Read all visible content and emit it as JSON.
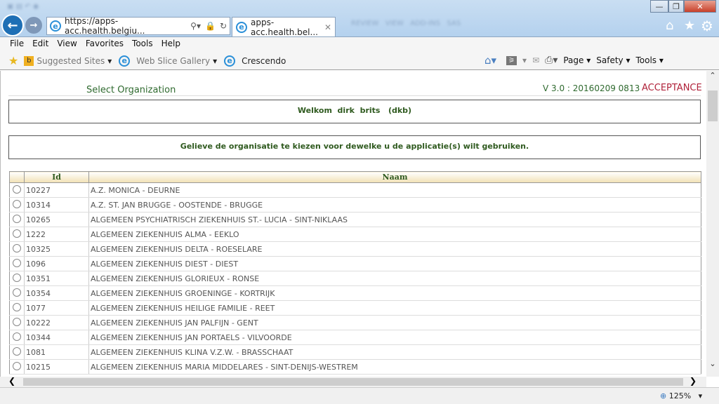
{
  "browser": {
    "address": "https://apps-acc.health.belgiu...",
    "tab_title": "apps-acc.health.bel...",
    "menu": [
      "File",
      "Edit",
      "View",
      "Favorites",
      "Tools",
      "Help"
    ],
    "favorites": [
      "Suggested Sites",
      "Web Slice Gallery",
      "Crescendo"
    ],
    "command_bar": [
      "Page",
      "Safety",
      "Tools"
    ],
    "zoom": "125%"
  },
  "page": {
    "title": "Select Organization",
    "version": "V 3.0 : 20160209 0813",
    "environment": "ACCEPTANCE",
    "welcome": "Welkom  dirk  brits   (dkb)",
    "instruction": "Gelieve de organisatie te kiezen voor dewelke u de applicatie(s) wilt gebruiken.",
    "columns": [
      "Id",
      "Naam"
    ],
    "rows": [
      {
        "id": "10227",
        "name": "A.Z. MONICA - DEURNE"
      },
      {
        "id": "10314",
        "name": "A.Z. ST. JAN BRUGGE - OOSTENDE - BRUGGE"
      },
      {
        "id": "10265",
        "name": "ALGEMEEN PSYCHIATRISCH ZIEKENHUIS ST.- LUCIA - SINT-NIKLAAS"
      },
      {
        "id": "1222",
        "name": "ALGEMEEN ZIEKENHUIS ALMA - EEKLO"
      },
      {
        "id": "10325",
        "name": "ALGEMEEN ZIEKENHUIS DELTA - ROESELARE"
      },
      {
        "id": "1096",
        "name": "ALGEMEEN ZIEKENHUIS DIEST - DIEST"
      },
      {
        "id": "10351",
        "name": "ALGEMEEN ZIEKENHUIS GLORIEUX - RONSE"
      },
      {
        "id": "10354",
        "name": "ALGEMEEN ZIEKENHUIS GROENINGE - KORTRIJK"
      },
      {
        "id": "1077",
        "name": "ALGEMEEN ZIEKENHUIS HEILIGE FAMILIE - REET"
      },
      {
        "id": "10222",
        "name": "ALGEMEEN ZIEKENHUIS JAN PALFIJN - GENT"
      },
      {
        "id": "10344",
        "name": "ALGEMEEN ZIEKENHUIS JAN PORTAELS - VILVOORDE"
      },
      {
        "id": "1081",
        "name": "ALGEMEEN ZIEKENHUIS KLINA V.Z.W. - BRASSCHAAT"
      },
      {
        "id": "10215",
        "name": "ALGEMEEN ZIEKENHUIS MARIA MIDDELARES - SINT-DENIJS-WESTREM"
      }
    ]
  }
}
